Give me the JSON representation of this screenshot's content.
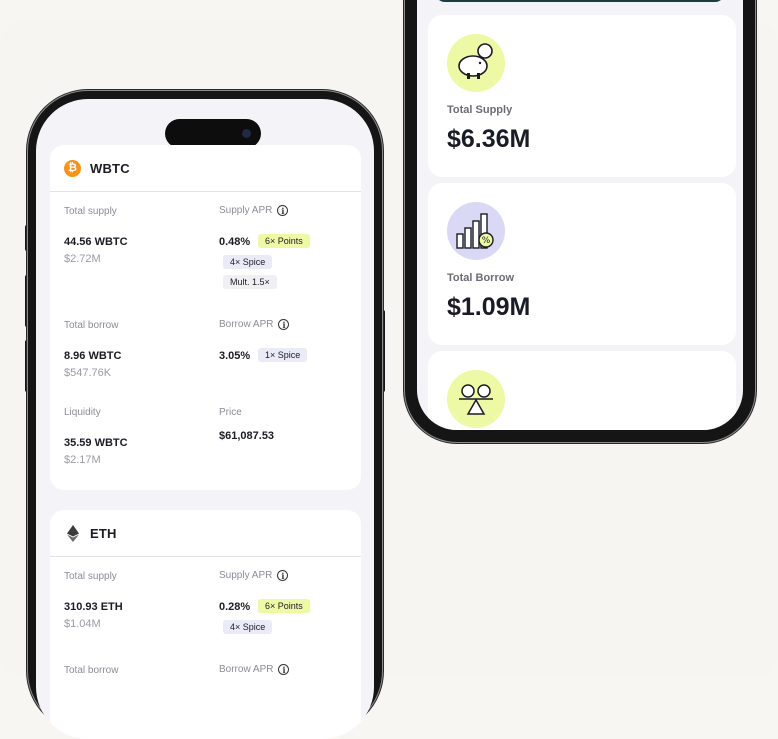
{
  "markets": [
    {
      "asset": "WBTC",
      "total_supply_label": "Total supply",
      "total_supply": "44.56 WBTC",
      "total_supply_usd": "$2.72M",
      "supply_apr_label": "Supply APR",
      "supply_apr": "0.48%",
      "supply_badges": [
        "6× Points",
        "4× Spice",
        "Mult. 1.5×"
      ],
      "total_borrow_label": "Total borrow",
      "total_borrow": "8.96 WBTC",
      "total_borrow_usd": "$547.76K",
      "borrow_apr_label": "Borrow APR",
      "borrow_apr": "3.05%",
      "borrow_badges": [
        "1× Spice"
      ],
      "liquidity_label": "Liquidity",
      "liquidity": "35.59 WBTC",
      "liquidity_usd": "$2.17M",
      "price_label": "Price",
      "price": "$61,087.53"
    },
    {
      "asset": "ETH",
      "total_supply_label": "Total supply",
      "total_supply": "310.93 ETH",
      "total_supply_usd": "$1.04M",
      "supply_apr_label": "Supply APR",
      "supply_apr": "0.28%",
      "supply_badges": [
        "6× Points",
        "4× Spice"
      ],
      "total_borrow_label": "Total borrow",
      "borrow_apr_label": "Borrow APR"
    }
  ],
  "stats": [
    {
      "label": "Total Supply",
      "value": "$6.36M",
      "icon": "piggy-bank-icon"
    },
    {
      "label": "Total Borrow",
      "value": "$1.09M",
      "icon": "bar-chart-percent-icon"
    },
    {
      "icon": "balance-scale-icon"
    }
  ],
  "colors": {
    "yellow_badge": "#eef9a6",
    "lavender_badge": "#ebebf8",
    "btc_orange": "#f7931a",
    "icon_green": "#eef9a6",
    "icon_lavender": "#d9d9f5"
  }
}
